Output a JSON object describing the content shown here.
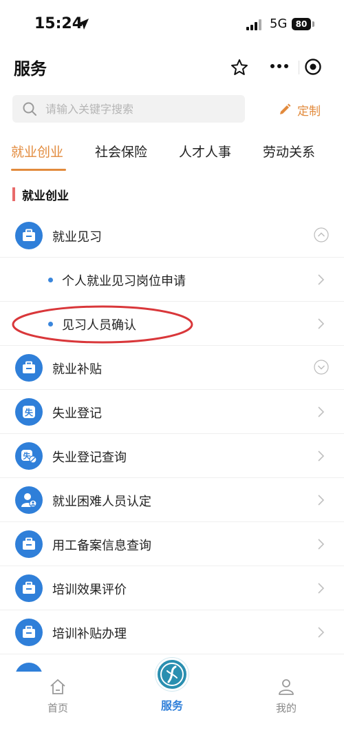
{
  "status_bar": {
    "time": "15:24",
    "network": "5G",
    "battery": "80"
  },
  "nav": {
    "title": "服务"
  },
  "search": {
    "placeholder": "请输入关键字搜索",
    "customize_label": "定制"
  },
  "tabs": [
    {
      "label": "就业创业",
      "active": true
    },
    {
      "label": "社会保险",
      "active": false
    },
    {
      "label": "人才人事",
      "active": false
    },
    {
      "label": "劳动关系",
      "active": false
    }
  ],
  "section": {
    "title": "就业创业"
  },
  "list": [
    {
      "label": "就业见习",
      "icon": "briefcase-icon",
      "expanded": true
    },
    {
      "label": "个人就业见习岗位申请",
      "sub": true
    },
    {
      "label": "见习人员确认",
      "sub": true,
      "highlighted": true
    },
    {
      "label": "就业补贴",
      "icon": "briefcase-icon",
      "expanded": false
    },
    {
      "label": "失业登记",
      "icon": "unemployment-icon"
    },
    {
      "label": "失业登记查询",
      "icon": "unemployment-search-icon"
    },
    {
      "label": "就业困难人员认定",
      "icon": "person-badge-icon"
    },
    {
      "label": "用工备案信息查询",
      "icon": "briefcase-icon"
    },
    {
      "label": "培训效果评价",
      "icon": "briefcase-icon"
    },
    {
      "label": "培训补贴办理",
      "icon": "briefcase-icon"
    }
  ],
  "tabbar": {
    "home_label": "首页",
    "service_label": "服务",
    "mine_label": "我的"
  },
  "colors": {
    "accent": "#e28a3c",
    "icon_blue": "#2f7fd9",
    "section_bar": "#e86b6b",
    "annotation": "#d9373a"
  }
}
